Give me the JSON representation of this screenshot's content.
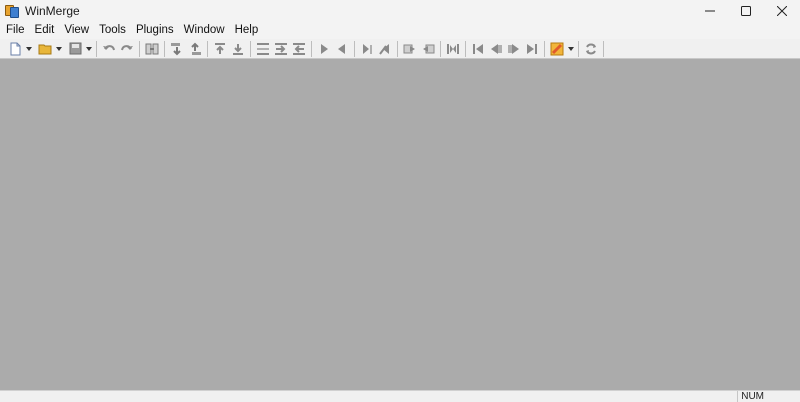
{
  "window": {
    "title": "WinMerge",
    "app_icon": "winmerge-app-icon"
  },
  "window_controls": [
    "minimize-icon",
    "maximize-icon",
    "close-icon"
  ],
  "menu": [
    {
      "label": "File"
    },
    {
      "label": "Edit"
    },
    {
      "label": "View"
    },
    {
      "label": "Tools"
    },
    {
      "label": "Plugins"
    },
    {
      "label": "Window"
    },
    {
      "label": "Help"
    }
  ],
  "toolbar": {
    "icons": [
      "new-document-icon",
      "open-folder-icon",
      "save-icon",
      "undo-icon",
      "redo-icon",
      "document-compare-icon",
      "next-diff-icon",
      "previous-diff-icon",
      "first-diff-icon",
      "last-diff-icon",
      "current-diff-icon",
      "copy-right-icon",
      "copy-left-icon",
      "copy-right-advance-icon",
      "copy-left-advance-icon",
      "all-right-icon",
      "all-left-icon",
      "merge-icon",
      "first-file-icon",
      "previous-file-icon",
      "next-file-icon",
      "last-file-icon",
      "options-icon",
      "refresh-icon"
    ],
    "accent_colors": {
      "folder": "#e8b63a",
      "options": "#e05a2b",
      "arrows": "#8a8a8a"
    }
  },
  "status": {
    "num_lock": "NUM"
  }
}
